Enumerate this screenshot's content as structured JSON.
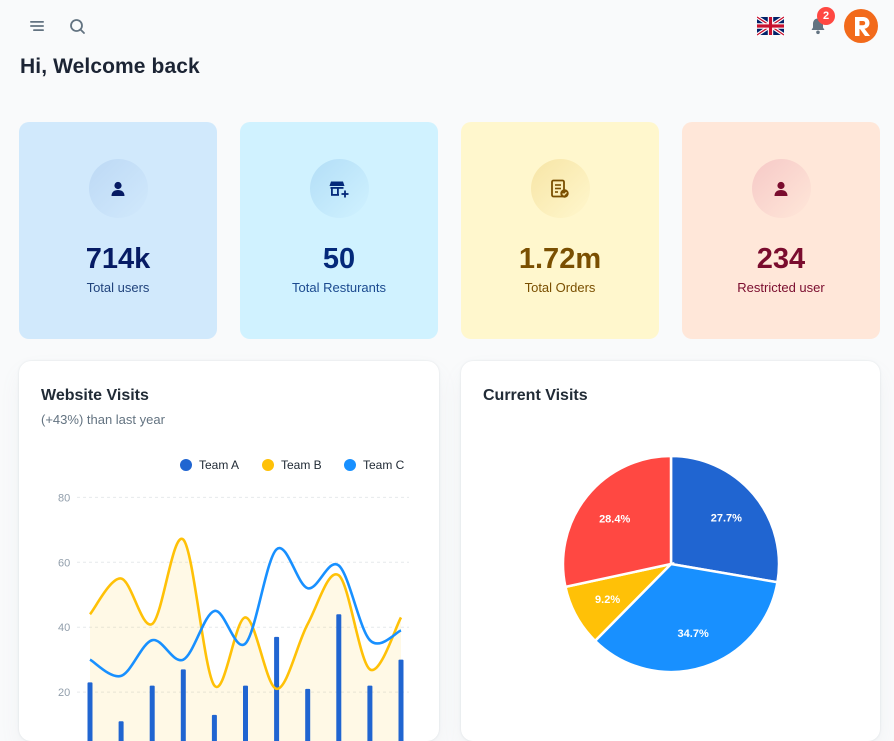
{
  "header": {
    "notification_count": "2",
    "language_flag": "uk-flag-icon"
  },
  "page": {
    "title": "Hi, Welcome back"
  },
  "stats": [
    {
      "value": "714k",
      "label": "Total users",
      "icon": "user-icon",
      "bg": "#d1e9fc",
      "iconbg": "#bdd9f5",
      "color": "#061b64",
      "labelColor": "#21437c"
    },
    {
      "value": "50",
      "label": "Total Resturants",
      "icon": "store-add-icon",
      "bg": "#d0f2ff",
      "iconbg": "#b3def7",
      "color": "#04297a",
      "labelColor": "#1b4a8f"
    },
    {
      "value": "1.72m",
      "label": "Total Orders",
      "icon": "order-check-icon",
      "bg": "#fff7cd",
      "iconbg": "#f7e5a6",
      "color": "#7a4f01",
      "labelColor": "#7a4f01"
    },
    {
      "value": "234",
      "label": "Restricted user",
      "icon": "user-icon",
      "bg": "#ffe7d9",
      "iconbg": "#f6c9c7",
      "color": "#7a0c2e",
      "labelColor": "#7a0c2e"
    }
  ],
  "website_visits": {
    "title": "Website Visits",
    "subtitle": "(+43%) than last year",
    "legend": [
      {
        "name": "Team A",
        "color": "#2065d1"
      },
      {
        "name": "Team B",
        "color": "#ffc107"
      },
      {
        "name": "Team C",
        "color": "#1890ff"
      }
    ]
  },
  "current_visits": {
    "title": "Current Visits"
  },
  "chart_data": [
    {
      "type": "line",
      "title": "Website Visits",
      "y_ticks": [
        "80",
        "60",
        "40",
        "20"
      ],
      "ylim": [
        0,
        80
      ],
      "grid": true,
      "legend_position": "top-right",
      "series": [
        {
          "name": "Team A",
          "type": "bar",
          "color": "#2065d1",
          "values": [
            23,
            11,
            22,
            27,
            13,
            22,
            37,
            21,
            44,
            22,
            30
          ]
        },
        {
          "name": "Team B",
          "type": "area",
          "color": "#ffc107",
          "values": [
            44,
            55,
            41,
            67,
            22,
            43,
            21,
            41,
            56,
            27,
            43
          ]
        },
        {
          "name": "Team C",
          "type": "line",
          "color": "#1890ff",
          "values": [
            30,
            25,
            36,
            30,
            45,
            35,
            64,
            52,
            59,
            36,
            39
          ]
        }
      ]
    },
    {
      "type": "pie",
      "title": "Current Visits",
      "slices": [
        {
          "label": "27.7%",
          "value": 27.7,
          "color": "#2065d1"
        },
        {
          "label": "34.7%",
          "value": 34.7,
          "color": "#1890ff"
        },
        {
          "label": "9.2%",
          "value": 9.2,
          "color": "#ffc107"
        },
        {
          "label": "28.4%",
          "value": 28.4,
          "color": "#ff4842"
        }
      ]
    }
  ]
}
